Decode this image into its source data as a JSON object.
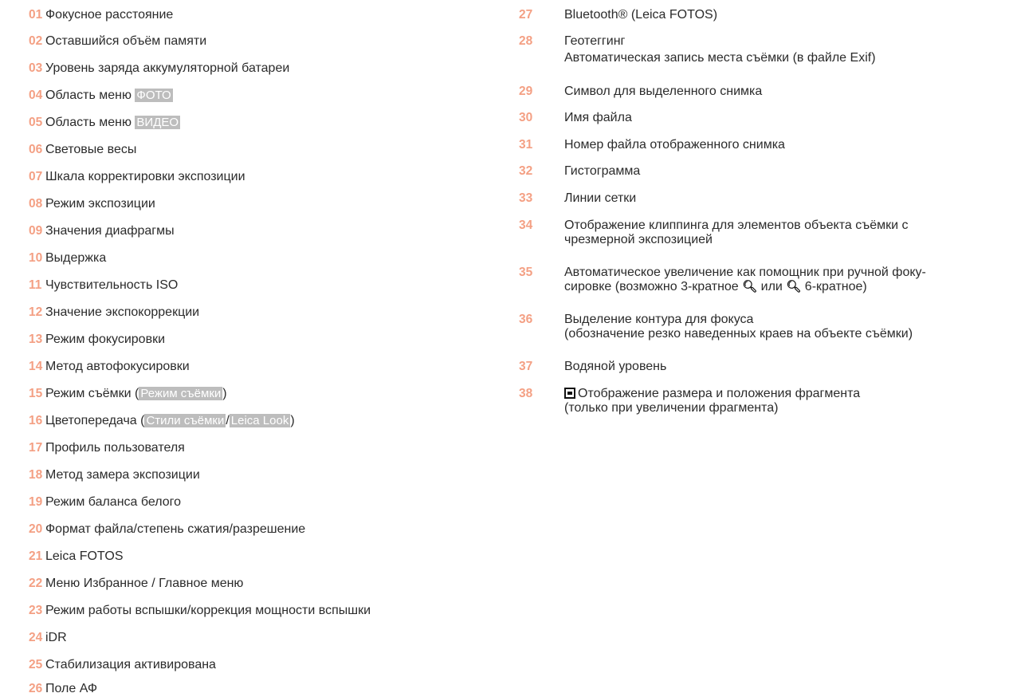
{
  "left": [
    {
      "num": "01",
      "lines": [
        "Фокусное расстояние"
      ]
    },
    {
      "num": "02",
      "lines": [
        "Оставшийся объём памяти"
      ]
    },
    {
      "num": "03",
      "lines": [
        "Уровень заряда аккумуляторной батареи"
      ]
    },
    {
      "num": "04",
      "text": "Область меню ",
      "tag": "ФОТО"
    },
    {
      "num": "05",
      "text": "Область меню ",
      "tag": "ВИДЕО"
    },
    {
      "num": "06",
      "lines": [
        "Световые весы"
      ]
    },
    {
      "num": "07",
      "lines": [
        "Шкала корректировки экспозиции"
      ]
    },
    {
      "num": "08",
      "lines": [
        "Режим экспозиции"
      ]
    },
    {
      "num": "09",
      "lines": [
        "Значения диафрагмы"
      ]
    },
    {
      "num": "10",
      "lines": [
        "Выдержка"
      ]
    },
    {
      "num": "11",
      "lines": [
        "Чувствительность ISO"
      ]
    },
    {
      "num": "12",
      "lines": [
        "Значение экспокоррекции"
      ]
    },
    {
      "num": "13",
      "lines": [
        "Режим фокусировки"
      ]
    },
    {
      "num": "14",
      "lines": [
        "Метод автофокусировки"
      ]
    },
    {
      "num": "15",
      "text": "Режим съёмки (",
      "tag": "Режим съёмки",
      "after": ")"
    },
    {
      "num": "16",
      "text": "Цветопередача (",
      "tag": "Стили съёмки",
      "mid": "/",
      "tag2": "Leica Look",
      "after": ")"
    },
    {
      "num": "17",
      "lines": [
        "Профиль пользователя"
      ]
    },
    {
      "num": "18",
      "lines": [
        "Метод замера экспозиции"
      ]
    },
    {
      "num": "19",
      "lines": [
        "Режим баланса белого"
      ]
    },
    {
      "num": "20",
      "lines": [
        "Формат файла/степень сжатия/разрешение"
      ]
    },
    {
      "num": "21",
      "lines": [
        "Leica FOTOS"
      ]
    },
    {
      "num": "22",
      "lines": [
        "Меню Избранное / Главное меню"
      ]
    },
    {
      "num": "23",
      "lines": [
        "Режим работы вспышки/коррекция мощности вспышки"
      ]
    },
    {
      "num": "24",
      "lines": [
        "iDR"
      ]
    },
    {
      "num": "25",
      "lines": [
        "Стабилизация активирована"
      ]
    },
    {
      "num": "26",
      "lines": [
        "Поле АФ"
      ]
    }
  ],
  "right": [
    {
      "num": "27",
      "lines": [
        "Bluetooth® (Leica FOTOS)"
      ]
    },
    {
      "num": "28",
      "lines": [
        "Геотеггинг",
        "Автоматическая запись места съёмки (в файле Exif)"
      ]
    },
    {
      "num": "29",
      "lines": [
        "Символ для выделенного снимка"
      ]
    },
    {
      "num": "30",
      "lines": [
        "Имя файла"
      ]
    },
    {
      "num": "31",
      "lines": [
        "Номер файла отображенного снимка"
      ]
    },
    {
      "num": "32",
      "lines": [
        "Гистограмма"
      ]
    },
    {
      "num": "33",
      "lines": [
        "Линии сетки"
      ]
    },
    {
      "num": "34",
      "lines": [
        "Отображение клиппинга для элементов объекта съёмки с",
        "чрезмерной экспозицией"
      ]
    },
    {
      "num": "35",
      "line1": "Автоматическое увеличение как помощник при ручной фоку-",
      "l2a": "сировке (возможно 3-кратное ",
      "l2b": " или ",
      "l2c": " 6-кратное)"
    },
    {
      "num": "36",
      "lines": [
        "Выделение контура для фокуса",
        "(обозначение резко наведенных краев на объекте съёмки)"
      ]
    },
    {
      "num": "37",
      "lines": [
        "Водяной уровень"
      ]
    },
    {
      "num": "38",
      "lines": [
        "Отображение размера и положения фрагмента",
        "(только при увеличении фрагмента)"
      ]
    }
  ]
}
